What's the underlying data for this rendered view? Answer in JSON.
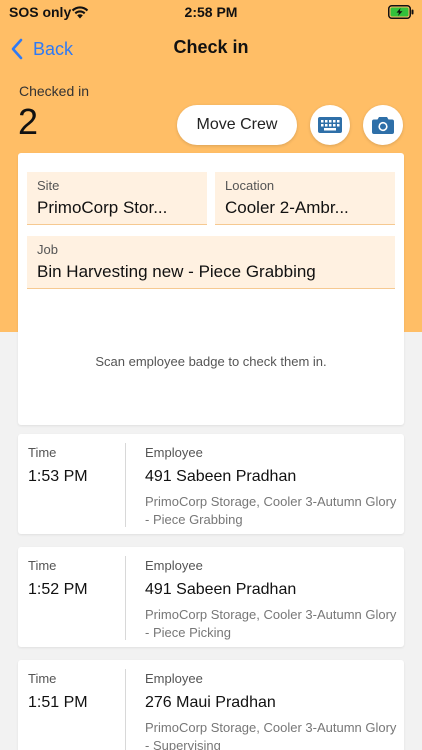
{
  "status_bar": {
    "carrier": "SOS only",
    "time": "2:58 PM"
  },
  "nav": {
    "back_label": "Back",
    "title": "Check in"
  },
  "summary": {
    "checked_label": "Checked in",
    "checked_count": "2"
  },
  "actions": {
    "move_crew_label": "Move Crew"
  },
  "scan": {
    "site_label": "Site",
    "site_value": "PrimoCorp Stor...",
    "location_label": "Location",
    "location_value": "Cooler 2-Ambr...",
    "job_label": "Job",
    "job_value": "Bin Harvesting new - Piece Grabbing",
    "hint": "Scan employee badge to check them in."
  },
  "entries": [
    {
      "time_label": "Time",
      "time": "1:53 PM",
      "employee_label": "Employee",
      "employee": "491 Sabeen Pradhan",
      "detail": "PrimoCorp Storage, Cooler 3-Autumn Glory - Piece Grabbing"
    },
    {
      "time_label": "Time",
      "time": "1:52 PM",
      "employee_label": "Employee",
      "employee": "491 Sabeen Pradhan",
      "detail": "PrimoCorp Storage, Cooler 3-Autumn Glory - Piece Picking"
    },
    {
      "time_label": "Time",
      "time": "1:51 PM",
      "employee_label": "Employee",
      "employee": "276 Maui Pradhan",
      "detail": "PrimoCorp Storage, Cooler 3-Autumn Glory - Supervising"
    }
  ],
  "colors": {
    "header": "#ffbe66",
    "accent": "#2f7af5",
    "field_bg": "#fff1e1",
    "icon_blue": "#2e6fa8"
  },
  "icons": [
    "wifi-icon",
    "battery-charging-icon",
    "chevron-left-icon",
    "keyboard-icon",
    "camera-icon"
  ]
}
